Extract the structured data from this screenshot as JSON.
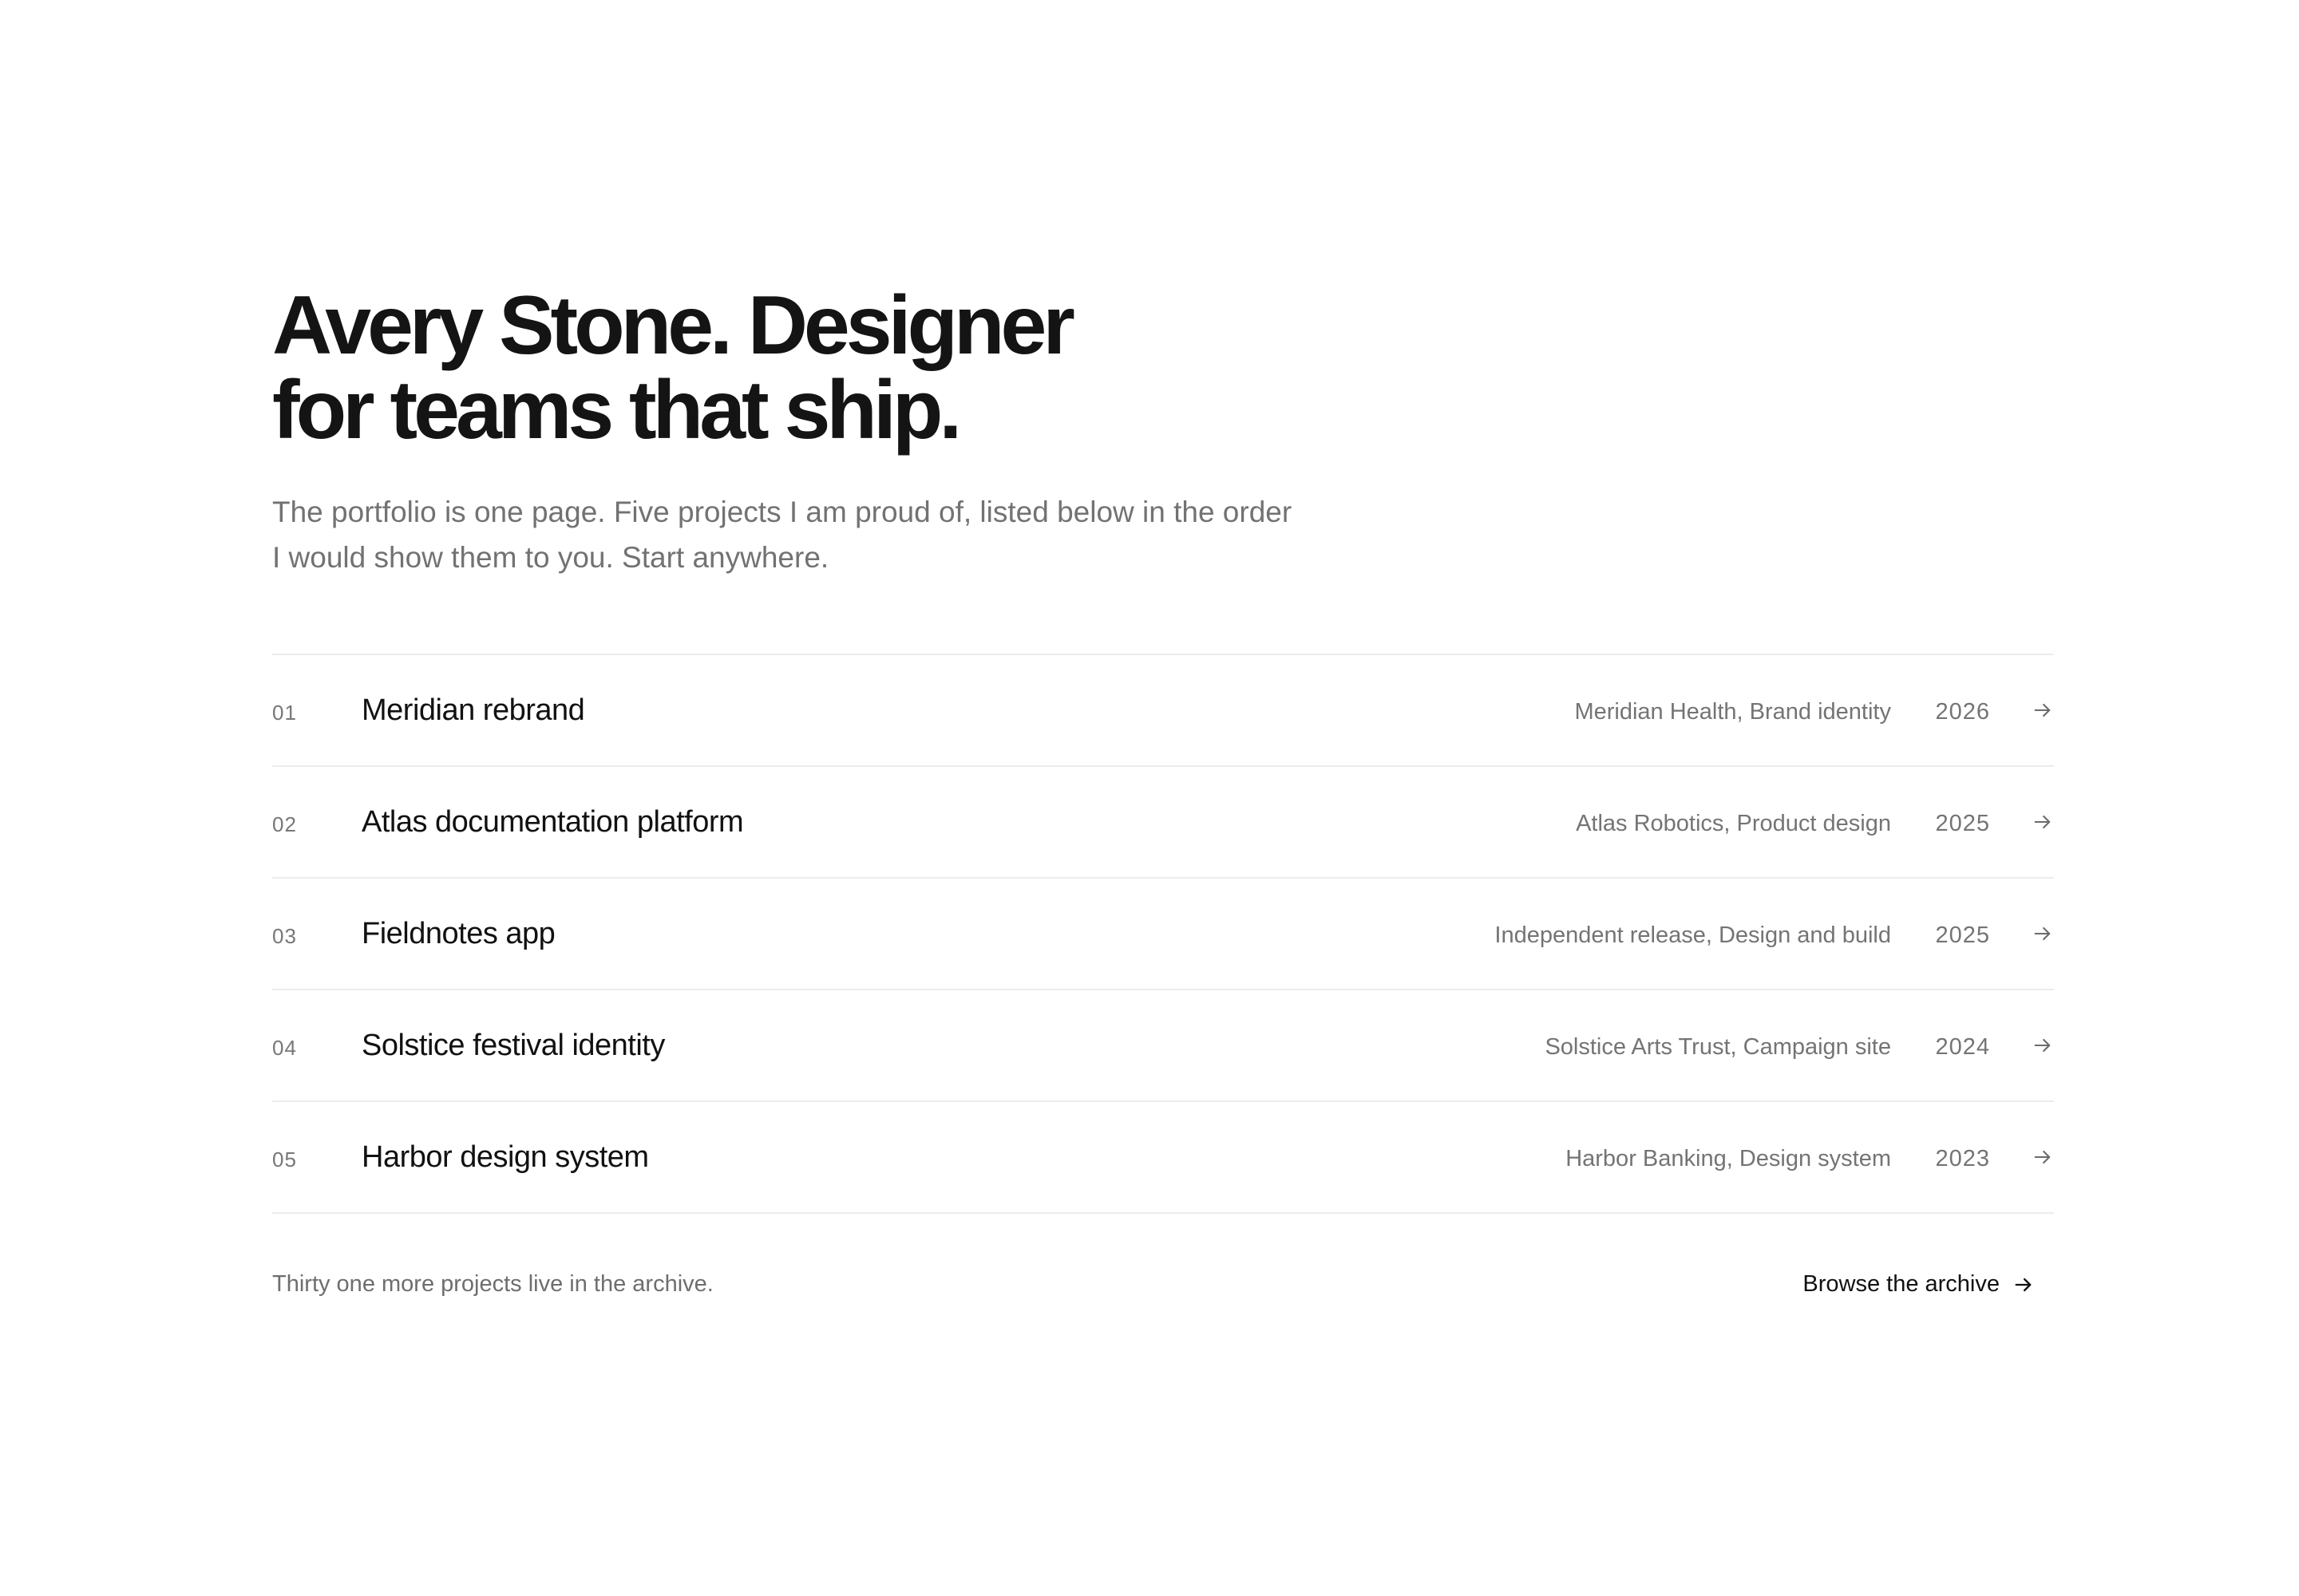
{
  "hero": {
    "title_line1": "Avery Stone. Designer",
    "title_line2": "for teams that ship.",
    "subtitle_line1": "The portfolio is one page. Five projects I am proud of, listed below in the order",
    "subtitle_line2": "I would show them to you. Start anywhere."
  },
  "projects": [
    {
      "number": "01",
      "name": "Meridian rebrand",
      "client": "Meridian Health, Brand identity",
      "year": "2026",
      "icon": "arrow-right-icon"
    },
    {
      "number": "02",
      "name": "Atlas documentation platform",
      "client": "Atlas Robotics, Product design",
      "year": "2025",
      "icon": "arrow-right-icon"
    },
    {
      "number": "03",
      "name": "Fieldnotes app",
      "client": "Independent release, Design and build",
      "year": "2025",
      "icon": "arrow-right-icon"
    },
    {
      "number": "04",
      "name": "Solstice festival identity",
      "client": "Solstice Arts Trust, Campaign site",
      "year": "2024",
      "icon": "arrow-right-icon"
    },
    {
      "number": "05",
      "name": "Harbor design system",
      "client": "Harbor Banking, Design system",
      "year": "2023",
      "icon": "arrow-right-icon"
    }
  ],
  "footer": {
    "note": "Thirty one more projects live in the archive.",
    "browse_label": "Browse the archive",
    "browse_icon": "arrow-right-icon"
  },
  "colors": {
    "background": "#ffffff",
    "title": "#141414",
    "muted": "#727272",
    "divider": "#ececec"
  }
}
